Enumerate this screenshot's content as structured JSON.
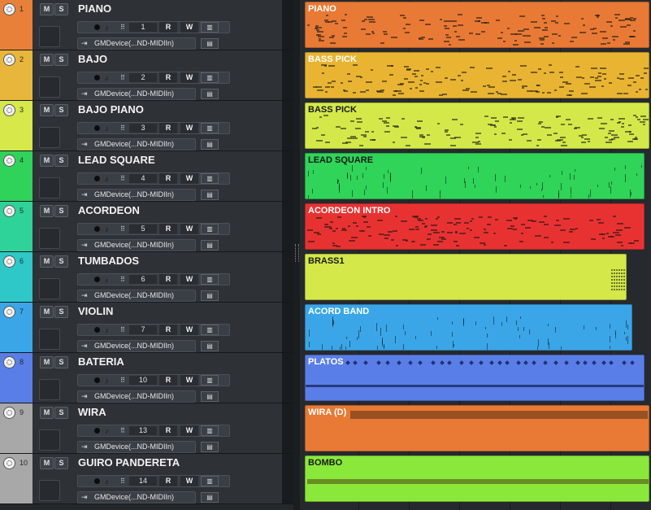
{
  "tracks": [
    {
      "num": "1",
      "name": "PIANO",
      "channel": "1",
      "device": "GMDevice(...ND-MIDIIn)",
      "color": "#e8803a"
    },
    {
      "num": "2",
      "name": "BAJO",
      "channel": "2",
      "device": "GMDevice(...ND-MIDIIn)",
      "color": "#e8b63a"
    },
    {
      "num": "3",
      "name": "BAJO PIANO",
      "channel": "3",
      "device": "GMDevice(...ND-MIDIIn)",
      "color": "#d6e84a"
    },
    {
      "num": "4",
      "name": "LEAD SQUARE",
      "channel": "4",
      "device": "GMDevice(...ND-MIDIIn)",
      "color": "#2fd35a"
    },
    {
      "num": "5",
      "name": "ACORDEON",
      "channel": "5",
      "device": "GMDevice(...ND-MIDIIn)",
      "color": "#2ed39a"
    },
    {
      "num": "6",
      "name": "TUMBADOS",
      "channel": "6",
      "device": "GMDevice(...ND-MIDIIn)",
      "color": "#2ec8c8"
    },
    {
      "num": "7",
      "name": "VIOLIN",
      "channel": "7",
      "device": "GMDevice(...ND-MIDIIn)",
      "color": "#3aa6e8"
    },
    {
      "num": "8",
      "name": "BATERIA",
      "channel": "10",
      "device": "GMDevice(...ND-MIDIIn)",
      "color": "#5a7ee8"
    },
    {
      "num": "9",
      "name": "WIRA",
      "channel": "13",
      "device": "GMDevice(...ND-MIDIIn)",
      "color": "#a8a8a8"
    },
    {
      "num": "10",
      "name": "GUIRO PANDERETA",
      "channel": "14",
      "device": "GMDevice(...ND-MIDIIn)",
      "color": "#a8a8a8"
    }
  ],
  "buttons": {
    "mute": "M",
    "solo": "S",
    "read": "R",
    "write": "W",
    "monitor": "♪",
    "channel_grid": "⠿",
    "columns": "▥",
    "edit": "▤",
    "output": "⇥"
  },
  "clips": [
    {
      "name": "PIANO",
      "color": "#e87a35",
      "text_color": "#ffffff",
      "end_fraction": 1.0,
      "pattern": "dense"
    },
    {
      "name": "BASS PICK",
      "color": "#e8b432",
      "text_color": "#ffffff",
      "end_fraction": 1.0,
      "pattern": "dense"
    },
    {
      "name": "BASS PICK",
      "color": "#d4e84a",
      "text_color": "#1a1a1a",
      "end_fraction": 1.0,
      "pattern": "dense"
    },
    {
      "name": "LEAD SQUARE",
      "color": "#2fd458",
      "text_color": "#1a1a1a",
      "end_fraction": 0.985,
      "pattern": "sparse"
    },
    {
      "name": "ACORDEON INTRO",
      "color": "#e83232",
      "text_color": "#ffffff",
      "end_fraction": 0.985,
      "pattern": "dense"
    },
    {
      "name": "BRASS1",
      "color": "#d4e84a",
      "text_color": "#1a1a1a",
      "end_fraction": 0.935,
      "pattern": "tail"
    },
    {
      "name": "ACORD BAND",
      "color": "#3aa6e8",
      "text_color": "#ffffff",
      "end_fraction": 0.95,
      "pattern": "sparse"
    },
    {
      "name": "PLATOS",
      "color": "#5a7ee8",
      "text_color": "#ffffff",
      "end_fraction": 0.985,
      "pattern": "drums"
    },
    {
      "name": "WIRA (D)",
      "color": "#e87a35",
      "text_color": "#ffffff",
      "end_fraction": 1.0,
      "pattern": "solid"
    },
    {
      "name": "BOMBO",
      "color": "#8ae83a",
      "text_color": "#1a1a1a",
      "end_fraction": 1.0,
      "pattern": "solid"
    }
  ]
}
